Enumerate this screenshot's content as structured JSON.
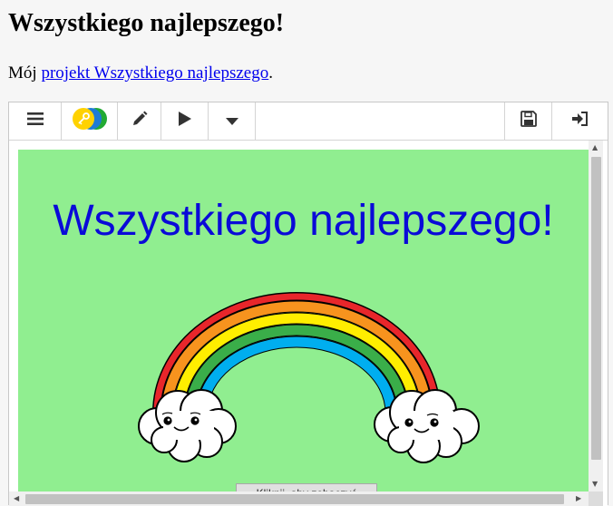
{
  "page": {
    "title": "Wszystkiego najlepszego!",
    "intro_prefix": "Mój ",
    "intro_link": "projekt Wszystkiego najlepszego",
    "intro_suffix": "."
  },
  "toolbar": {
    "buttons": [
      {
        "name": "menu",
        "icon": "hamburger-icon"
      },
      {
        "name": "fullscreen-toggle",
        "icon": "key-icon",
        "colors": [
          "#ffd200",
          "#1e7bd4",
          "#22aa33"
        ]
      },
      {
        "name": "edit",
        "icon": "pencil-icon"
      },
      {
        "name": "run",
        "icon": "play-icon"
      },
      {
        "name": "more",
        "icon": "caret-down-icon"
      },
      {
        "name": "save",
        "icon": "floppy-disk-icon"
      },
      {
        "name": "sign-in",
        "icon": "sign-in-icon"
      }
    ]
  },
  "stage": {
    "background": "#90ee90",
    "heading": "Wszystkiego najlepszego!",
    "heading_color": "#0a0ad8",
    "button_label": "Kliknij, aby zobaczyć",
    "rainbow_colors": [
      "#e8262b",
      "#f7931e",
      "#ffee00",
      "#3aae49",
      "#00aeef"
    ]
  }
}
